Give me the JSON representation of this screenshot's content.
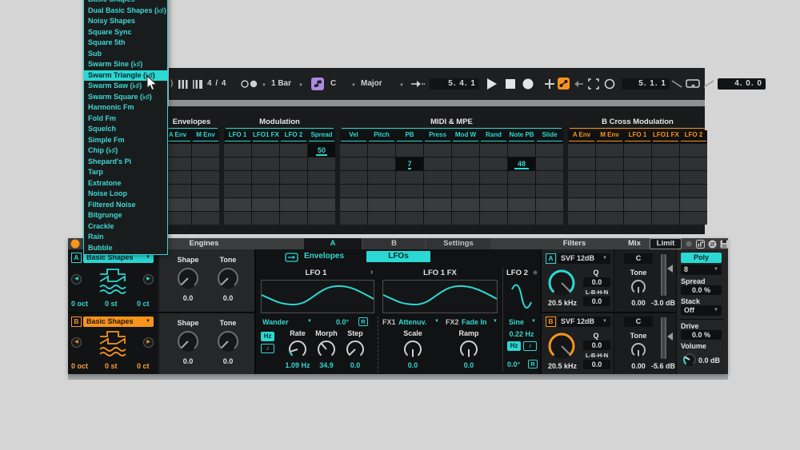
{
  "colors": {
    "cyan": "#2bd8d3",
    "orange": "#f7941d",
    "purple": "#ab8ae0"
  },
  "menu": {
    "selected_index": 7,
    "items": [
      "Basic Shapes",
      "Dual Basic Shapes  (♭♯)",
      "Noisy Shapes",
      "Square Sync",
      "Square 5th",
      "Sub",
      "Swarm Sine  (♭♯)",
      "Swarm Triangle  (♭♯)",
      "Swarm Saw  (♭♯)",
      "Swarm Square  (♭♯)",
      "Harmonic Fm",
      "Fold Fm",
      "Squelch",
      "Simple Fm",
      "Chip  (♭♯)",
      "Shepard's Pi",
      "Tarp",
      "Extratone",
      "Noise Loop",
      "Filtered Noise",
      "Bitgrunge",
      "Crackle",
      "Rain",
      "Bubble"
    ]
  },
  "toolbar": {
    "tap_partial": ")",
    "time_sig": "4 / 4",
    "quantize": "1 Bar",
    "root": "C",
    "scale_name": "Major",
    "position": "5. 4. 1",
    "loop_start": "5. 1. 1",
    "loop_length": "4. 0. 0"
  },
  "matrix": {
    "rows": 6,
    "groups": [
      {
        "label": "Envelopes",
        "accent": "cyan",
        "columns": [
          "A Env",
          "M Env"
        ]
      },
      {
        "label": "Modulation",
        "accent": "cyan",
        "columns": [
          "LFO 1",
          "LFO1 FX",
          "LFO 2",
          "Spread"
        ]
      },
      {
        "label": "MIDI & MPE",
        "accent": "cyan",
        "columns": [
          "Vel",
          "Pitch",
          "PB",
          "Press",
          "Mod W",
          "Rand",
          "Note PB",
          "Slide"
        ]
      },
      {
        "label": "B Cross Modulation",
        "accent": "orange",
        "columns": [
          "A Env",
          "M Env",
          "LFO 1",
          "LFO1 FX",
          "LFO 2"
        ]
      }
    ],
    "values": [
      {
        "group": 1,
        "column": 3,
        "row": 0,
        "value": "50",
        "bar": 14
      },
      {
        "group": 2,
        "column": 2,
        "row": 1,
        "value": "7",
        "bar": 4
      },
      {
        "group": 2,
        "column": 6,
        "row": 1,
        "value": "48",
        "bar": 18
      }
    ]
  },
  "device": {
    "header": {
      "engines_title": "Engines",
      "tabs": [
        {
          "label": "A"
        },
        {
          "label": "B"
        },
        {
          "label": "Settings"
        }
      ],
      "selected_tab": "A",
      "filters_title": "Filters",
      "mix_title": "Mix",
      "limit_label": "Limit"
    },
    "engine_a": {
      "letter": "A",
      "shape": "Basic Shapes",
      "oct": "0 oct",
      "st": "0 st",
      "ct": "0 ct",
      "shape_label": "Shape",
      "shape_value": "0.0",
      "tone_label": "Tone",
      "tone_value": "0.0"
    },
    "engine_b": {
      "letter": "B",
      "shape": "Basic Shapes",
      "oct": "0 oct",
      "st": "0 st",
      "ct": "0 ct",
      "shape_label": "Shape",
      "shape_value": "0.0",
      "tone_label": "Tone",
      "tone_value": "0.0"
    },
    "panel": {
      "envelopes_tab": "Envelopes",
      "lfos_tab": "LFOs",
      "lfo1": {
        "title": "LFO 1",
        "mode": "Wander",
        "phase": "0.0°",
        "retrig": "R",
        "hz": "Hz",
        "note": "♪",
        "rate_label": "Rate",
        "rate_value": "1.09 Hz",
        "morph_label": "Morph",
        "morph_value": "34.9",
        "step_label": "Step",
        "step_value": "0.0"
      },
      "lfo1fx": {
        "title": "LFO 1 FX",
        "fx1_label": "FX1",
        "fx1_value": "Attenuv.",
        "fx2_label": "FX2",
        "fx2_value": "Fade In",
        "scale_label": "Scale",
        "scale_value": "0.0",
        "ramp_label": "Ramp",
        "ramp_value": "0.0"
      },
      "lfo2": {
        "title": "LFO 2",
        "shape": "Sine",
        "rate": "0.22 Hz",
        "hz": "Hz",
        "note": "♪",
        "phase": "0.0°",
        "retrig": "R"
      }
    },
    "filter_a": {
      "letter": "A",
      "type": "SVF 12dB",
      "freq": "20.5 kHz",
      "q_label": "Q",
      "q_value": "0.0",
      "morph_label": "L-B-H-N",
      "morph_value": "0.0"
    },
    "filter_b": {
      "letter": "B",
      "type": "SVF 12dB",
      "freq": "20.5 kHz",
      "q_label": "Q",
      "q_value": "0.0",
      "morph_label": "L-B-H-N",
      "morph_value": "0.0"
    },
    "mix_a": {
      "center": "C",
      "tone_label": "Tone",
      "tone_value": "0.00",
      "level": "-3.0 dB"
    },
    "mix_b": {
      "center": "C",
      "tone_label": "Tone",
      "tone_value": "0.00",
      "level": "-5.6 dB"
    },
    "global": {
      "poly": "Poly",
      "voices": "8",
      "spread_label": "Spread",
      "spread_value": "0.0 %",
      "stack_label": "Stack",
      "stack_value": "Off",
      "drive_label": "Drive",
      "drive_value": "0.0 %",
      "volume_label": "Volume",
      "volume_value": "0.0 dB"
    }
  }
}
